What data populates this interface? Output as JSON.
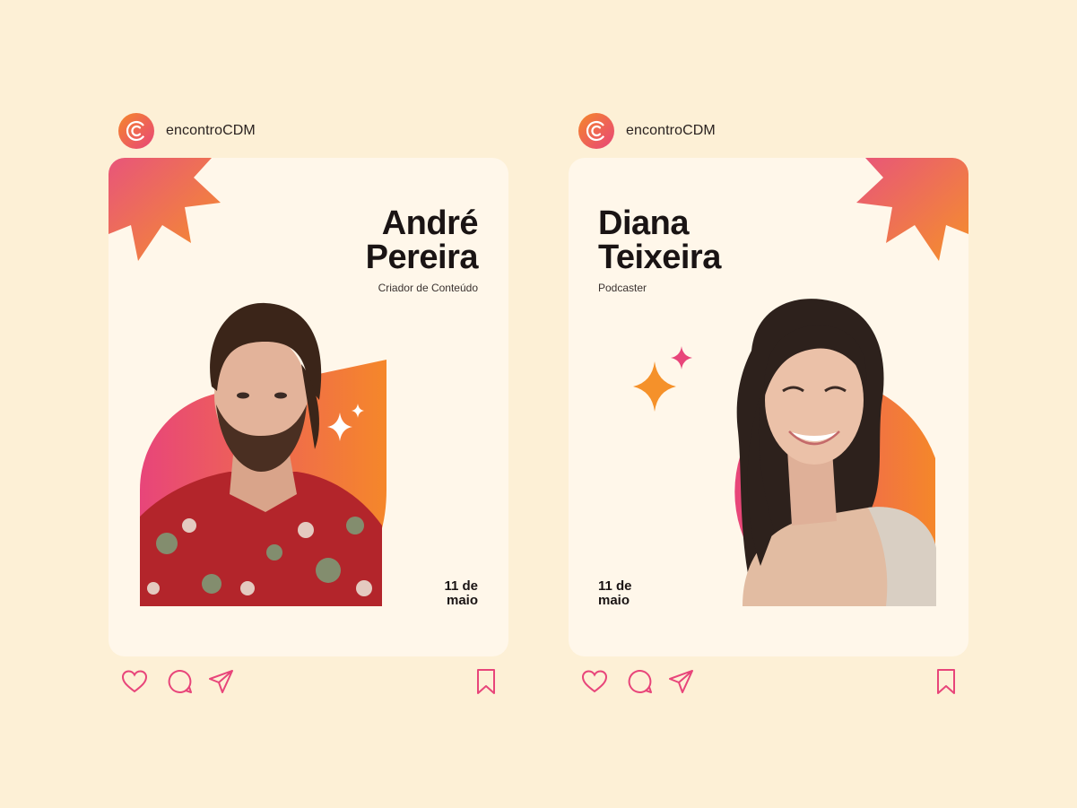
{
  "colors": {
    "background": "#fdf0d6",
    "card": "#fff7ea",
    "accent_orange": "#f5872a",
    "accent_pink": "#e8457a"
  },
  "posts": [
    {
      "handle": "encontroCDM",
      "name_line1": "André",
      "name_line2": "Pereira",
      "role": "Criador de Conteúdo",
      "date_line1": "11 de",
      "date_line2": "maio"
    },
    {
      "handle": "encontroCDM",
      "name_line1": "Diana",
      "name_line2": "Teixeira",
      "role": "Podcaster",
      "date_line1": "11 de",
      "date_line2": "maio"
    }
  ],
  "icons": [
    "heart-icon",
    "comment-icon",
    "send-icon",
    "bookmark-icon",
    "sparkle-icon",
    "starburst-icon",
    "logo-icon"
  ]
}
